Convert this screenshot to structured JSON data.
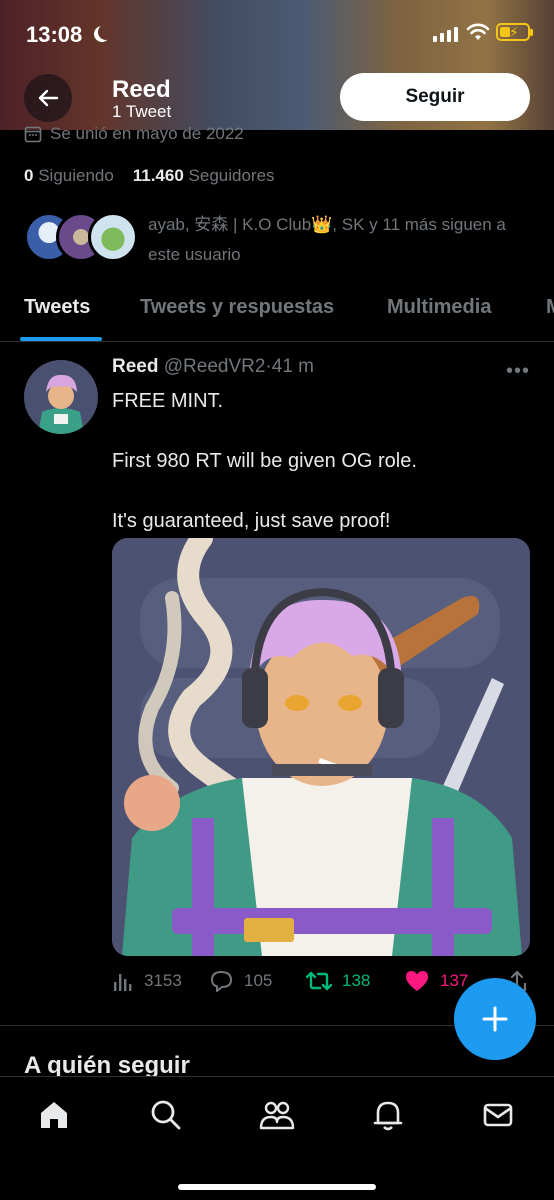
{
  "status_bar": {
    "time": "13:08"
  },
  "header": {
    "name": "Reed",
    "tweet_count": "1 Tweet",
    "follow_label": "Seguir"
  },
  "profile": {
    "joined": "Se unió en mayo de 2022",
    "following_count": "0",
    "following_label": "Siguiendo",
    "followers_count": "11.460",
    "followers_label": "Seguidores",
    "followed_by": "ayab, 安森 | K.O Club👑, SK y 11 más siguen a este usuario"
  },
  "tabs": [
    {
      "label": "Tweets"
    },
    {
      "label": "Tweets y respuestas"
    },
    {
      "label": "Multimedia"
    },
    {
      "label": "M"
    }
  ],
  "tweet": {
    "name": "Reed",
    "handle": "@ReedVR2",
    "separator": "·",
    "time": "41 m",
    "text": "FREE MINT.\n\nFirst 980 RT will be given OG role.\n\nIt's guaranteed, just save proof!",
    "views": "3153",
    "replies": "105",
    "retweets": "138",
    "likes": "137"
  },
  "who_to_follow": "A quién seguir",
  "colors": {
    "accent": "#1d9bf0",
    "retweet": "#00ba7c",
    "like": "#f91880"
  }
}
